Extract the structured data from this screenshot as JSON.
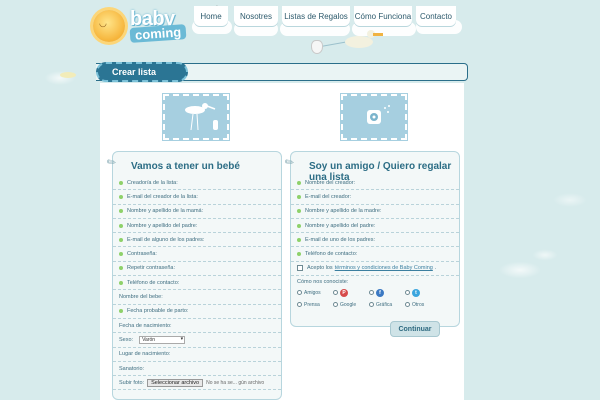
{
  "brand": {
    "line1": "baby",
    "line2": "coming"
  },
  "nav": [
    "Home",
    "Nosotres",
    "Listas de Regalos",
    "Cómo Funciona",
    "Contacto"
  ],
  "panel_title": "Crear lista",
  "left_card": {
    "title": "Vamos a tener un bebé",
    "fields": [
      "Creador/a de la lista:",
      "E-mail del creador de la lista:",
      "Nombre y apellido de la mamá:",
      "Nombre y apellido del padre:",
      "E-mail de alguno de los padres:",
      "Contraseña:",
      "Repetir contraseña:",
      "Teléfono de contacto:",
      "Nombre del bebe:",
      "Fecha probable de parto:",
      "Fecha de nacimiento:"
    ],
    "sexo_label": "Sexo:",
    "sexo_value": "Varón",
    "more_fields": [
      "Lugar de nacimiento:",
      "Sanatorio:"
    ],
    "photo_label": "Subir foto:",
    "file_button": "Seleccionar archivo",
    "file_status": "No se ha se... gún archivo"
  },
  "right_card": {
    "title": "Soy un amigo / Quiero regalar una lista",
    "fields": [
      "Nombre del creador:",
      "E-mail del creador:",
      "Nombre y apellido de la madre:",
      "Nombre y apellido del padre:",
      "E-mail de uno de los padres:",
      "Teléfono de contacto:"
    ],
    "terms_prefix": "Acepto los",
    "terms_link": "términos y condiciones de Baby Coming",
    "terms_suffix": ".",
    "how_label": "Cómo nos conociste:",
    "options": [
      "Amigos",
      "",
      "",
      "",
      "Prensa",
      "Google",
      "Gráfica",
      "Otros"
    ]
  },
  "continue_label": "Continuar"
}
